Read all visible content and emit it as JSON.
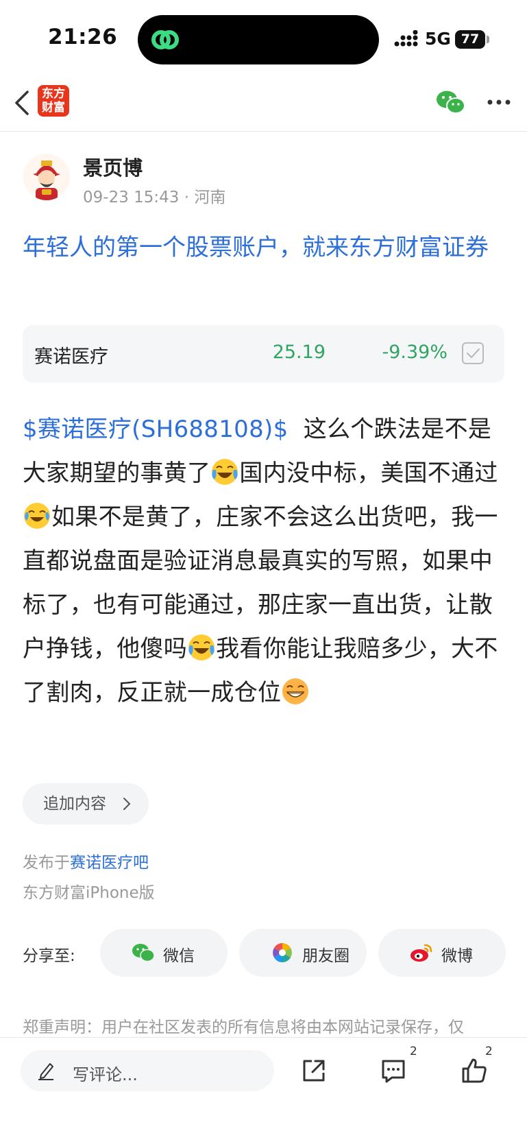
{
  "status_bar": {
    "time": "21:26",
    "network": "5G",
    "battery": "77"
  },
  "nav": {
    "logo_text_line1": "东方",
    "logo_text_line2": "财富"
  },
  "author": {
    "name": "景页博",
    "meta": "09-23 15:43 · 河南"
  },
  "post": {
    "title": "年轻人的第一个股票账户，就来东方财富证券",
    "stock": {
      "name": "赛诺医疗",
      "price": "25.19",
      "change": "-9.39%"
    },
    "body": {
      "tag": "$赛诺医疗(SH688108)$",
      "p1": "这么个跌法是不是大家期望的事黄了",
      "p2": "国内没中标，美国不通过",
      "p3": "如果不是黄了，庄家不会这么出货吧，我一直都说盘面是验证消息最真实的写照，如果中标了，也有可能通过，那庄家一直出货，让散户挣钱，他傻吗",
      "p4": "我看你能让我赔多少，大不了割肉，反正就一成仓位"
    },
    "append_label": "追加内容",
    "published_prefix": "发布于",
    "published_bar": "赛诺医疗吧",
    "device": "东方财富iPhone版"
  },
  "share": {
    "label": "分享至:",
    "wechat": "微信",
    "moments": "朋友圈",
    "weibo": "微博"
  },
  "disclaimer": "郑重声明：用户在社区发表的所有信息将由本网站记录保存，仅",
  "bottom_bar": {
    "comment_placeholder": "写评论...",
    "comment_count": "2",
    "like_count": "2"
  },
  "colors": {
    "link_blue": "#2c6fd8",
    "stock_green": "#2fa564",
    "brand_red": "#e8361e"
  }
}
